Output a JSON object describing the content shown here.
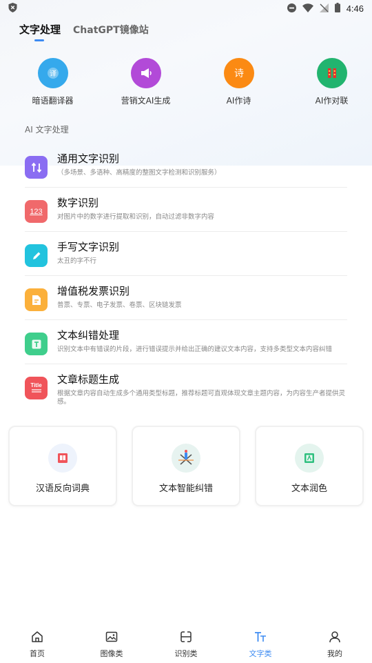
{
  "status_bar": {
    "time": "4:46"
  },
  "top_tabs": [
    {
      "label": "文字处理",
      "active": true
    },
    {
      "label": "ChatGPT镜像站",
      "active": false
    }
  ],
  "quick_actions": [
    {
      "label": "暗语翻译器",
      "icon": "translate-icon",
      "color": "#35a9ec",
      "glyph": "译"
    },
    {
      "label": "营销文AI生成",
      "icon": "megaphone-icon",
      "color": "#b24ad8",
      "glyph": ""
    },
    {
      "label": "AI作诗",
      "icon": "poem-icon",
      "color": "#fb8a13",
      "glyph": "诗"
    },
    {
      "label": "AI作对联",
      "icon": "couplet-icon",
      "color": "#22b46f",
      "glyph": ""
    }
  ],
  "section_title": "AI 文字处理",
  "list_items": [
    {
      "title": "通用文字识别",
      "desc": "（多场景、多语种、高精度的整图文字检测和识别服务）",
      "icon": "text-recognition-icon",
      "color": "#8a6df2"
    },
    {
      "title": "数字识别",
      "desc": "对图片中的数字进行提取和识别，自动过滤非数字内容",
      "icon": "number-recognition-icon",
      "color": "#f0696b",
      "glyph": "123"
    },
    {
      "title": "手写文字识别",
      "desc": "太丑的字不行",
      "icon": "handwriting-icon",
      "color": "#22c3de"
    },
    {
      "title": "增值税发票识别",
      "desc": "普票、专票、电子发票、卷票、区块链发票",
      "icon": "invoice-icon",
      "color": "#fbb03b"
    },
    {
      "title": "文本纠错处理",
      "desc": "识别文本中有错误的片段，进行错误提示并给出正确的建议文本内容，支持多类型文本内容纠错",
      "icon": "text-correction-icon",
      "color": "#3fce8c"
    },
    {
      "title": "文章标题生成",
      "desc": "根据文章内容自动生成多个通用类型标题，推荐标题可直观体现文章主题内容，为内容生产者提供灵感。",
      "icon": "title-icon",
      "color": "#f0545a",
      "glyph": "Title"
    }
  ],
  "cards": [
    {
      "label": "汉语反向词典",
      "icon": "dictionary-icon",
      "bg": "#eef3fc"
    },
    {
      "label": "文本智能纠错",
      "icon": "correction-icon",
      "bg": "#e7f3f0"
    },
    {
      "label": "文本润色",
      "icon": "polish-icon",
      "bg": "#e4f4ee"
    }
  ],
  "bottom_nav": [
    {
      "label": "首页",
      "icon": "home-icon",
      "active": false
    },
    {
      "label": "图像类",
      "icon": "image-icon",
      "active": false
    },
    {
      "label": "识别类",
      "icon": "scan-icon",
      "active": false
    },
    {
      "label": "文字类",
      "icon": "text-icon",
      "active": true
    },
    {
      "label": "我的",
      "icon": "profile-icon",
      "active": false
    }
  ]
}
